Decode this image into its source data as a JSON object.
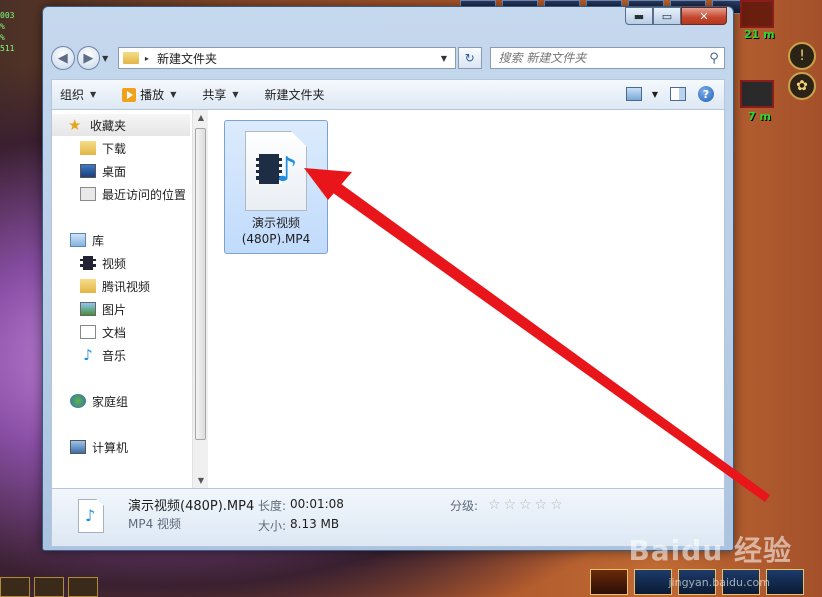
{
  "game_hud": {
    "left_lines": [
      "003",
      "%",
      "%",
      "511"
    ],
    "right_top_dist": "21 m",
    "right_mid_dist": "7 m"
  },
  "window": {
    "controls": {
      "minimize": "▬",
      "maximize": "▭",
      "close": "✕"
    }
  },
  "address_bar": {
    "back_glyph": "◀",
    "forward_glyph": "▶",
    "path_separator": "▸",
    "path": "新建文件夹",
    "refresh_glyph": "↻"
  },
  "search": {
    "placeholder": "搜索 新建文件夹",
    "icon": "search-icon"
  },
  "toolbar": {
    "organize": "组织",
    "play": "播放",
    "share": "共享",
    "new_folder": "新建文件夹",
    "help": "?"
  },
  "nav_pane": {
    "favorites": "收藏夹",
    "downloads": "下载",
    "desktop": "桌面",
    "recent": "最近访问的位置",
    "libraries": "库",
    "videos": "视频",
    "tencent_video": "腾讯视频",
    "pictures": "图片",
    "documents": "文档",
    "music": "音乐",
    "homegroup": "家庭组",
    "computer": "计算机"
  },
  "file": {
    "name_line1": "演示视频",
    "name_line2": "(480P).MP4"
  },
  "details": {
    "file_name": "演示视频(480P).MP4",
    "file_type": "MP4 视频",
    "length_label": "长度:",
    "length_value": "00:01:08",
    "size_label": "大小:",
    "size_value": "8.13 MB",
    "rating_label": "分级:",
    "rating_stars": "☆☆☆☆☆"
  },
  "watermark": {
    "brand": "Baidu 经验",
    "url": "jingyan.baidu.com"
  },
  "colors": {
    "arrow": "#e8161a",
    "selection": "#c1dbfc",
    "chrome": "#b7cde6"
  }
}
